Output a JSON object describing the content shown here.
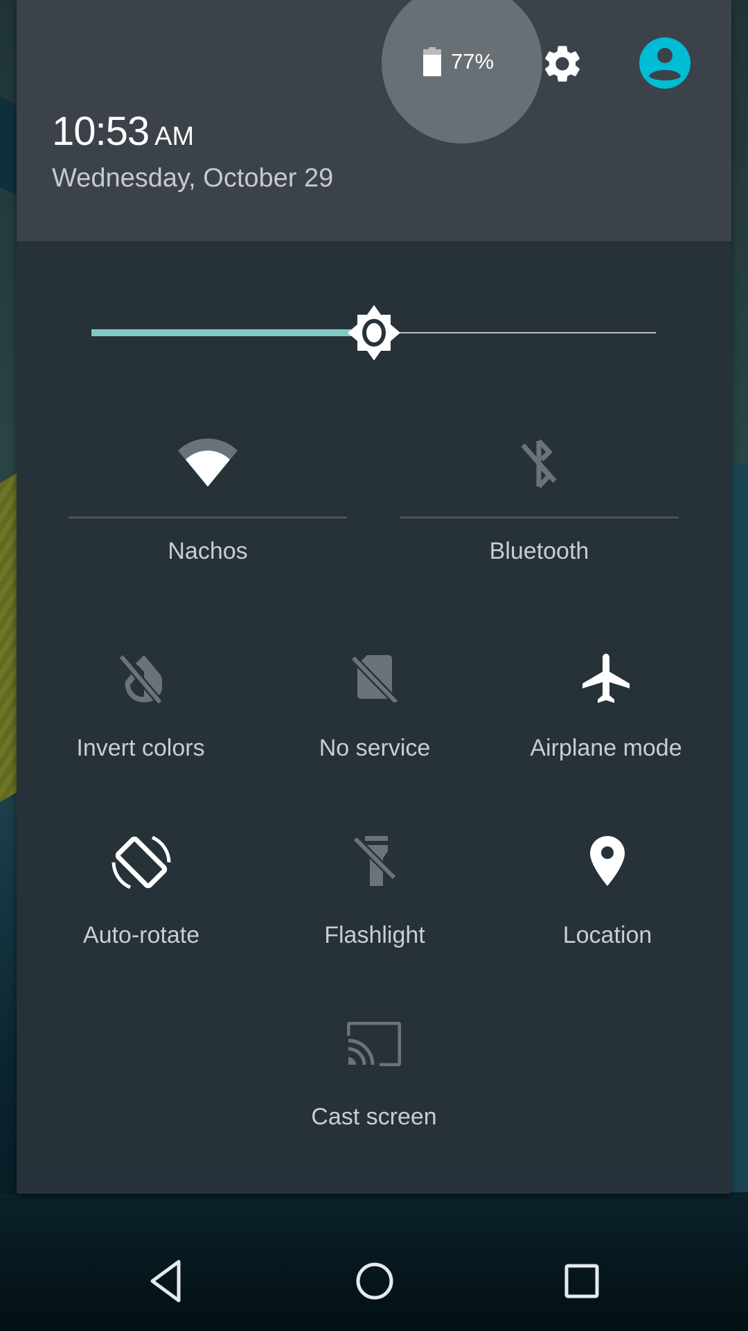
{
  "header": {
    "battery_label": "77%",
    "battery_level_percent": 77,
    "time": "10:53",
    "ampm": "AM",
    "date": "Wednesday, October 29",
    "settings_icon": "gear-icon",
    "user_icon": "account-circle-icon",
    "accent_color": "#00bcd4"
  },
  "brightness": {
    "label": "Brightness",
    "level_fraction": 0.5,
    "fill_color": "#80cbc4"
  },
  "tiles_large": [
    {
      "label": "Nachos",
      "icon": "wifi-icon",
      "state": "on"
    },
    {
      "label": "Bluetooth",
      "icon": "bluetooth-disabled-icon",
      "state": "off"
    }
  ],
  "tiles": [
    {
      "label": "Invert colors",
      "icon": "invert-colors-off-icon",
      "state": "off"
    },
    {
      "label": "No service",
      "icon": "sim-card-off-icon",
      "state": "off"
    },
    {
      "label": "Airplane mode",
      "icon": "airplane-icon",
      "state": "on"
    },
    {
      "label": "Auto-rotate",
      "icon": "screen-rotation-icon",
      "state": "on"
    },
    {
      "label": "Flashlight",
      "icon": "flashlight-off-icon",
      "state": "off"
    },
    {
      "label": "Location",
      "icon": "location-pin-icon",
      "state": "on"
    },
    {
      "label": "Cast screen",
      "icon": "cast-icon",
      "state": "off"
    }
  ],
  "nav": {
    "back": "back-icon",
    "home": "home-icon",
    "recents": "recents-icon"
  }
}
